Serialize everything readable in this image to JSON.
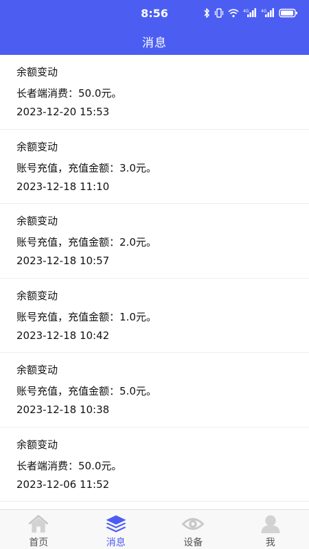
{
  "status_bar": {
    "time": "8:56",
    "icons": [
      "bluetooth-icon",
      "vibrate-icon",
      "wifi-icon",
      "signal-4g-icon",
      "signal-4g-icon",
      "battery-icon"
    ]
  },
  "header": {
    "title": "消息"
  },
  "messages": [
    {
      "title": "余额变动",
      "body": "长者端消费：50.0元。",
      "time": "2023-12-20 15:53"
    },
    {
      "title": "余额变动",
      "body": "账号充值，充值金额：3.0元。",
      "time": "2023-12-18 11:10"
    },
    {
      "title": "余额变动",
      "body": "账号充值，充值金额：2.0元。",
      "time": "2023-12-18 10:57"
    },
    {
      "title": "余额变动",
      "body": "账号充值，充值金额：1.0元。",
      "time": "2023-12-18 10:42"
    },
    {
      "title": "余额变动",
      "body": "账号充值，充值金额：5.0元。",
      "time": "2023-12-18 10:38"
    },
    {
      "title": "余额变动",
      "body": "长者端消费：50.0元。",
      "time": "2023-12-06 11:52"
    }
  ],
  "tabbar": {
    "tabs": [
      {
        "label": "首页",
        "icon": "home-icon",
        "active": false
      },
      {
        "label": "消息",
        "icon": "layers-icon",
        "active": true
      },
      {
        "label": "设备",
        "icon": "eye-icon",
        "active": false
      },
      {
        "label": "我",
        "icon": "user-icon",
        "active": false
      }
    ]
  },
  "colors": {
    "accent": "#4c5ef2",
    "inactive_icon": "#c8c8c8",
    "divider": "#eeeeee"
  }
}
